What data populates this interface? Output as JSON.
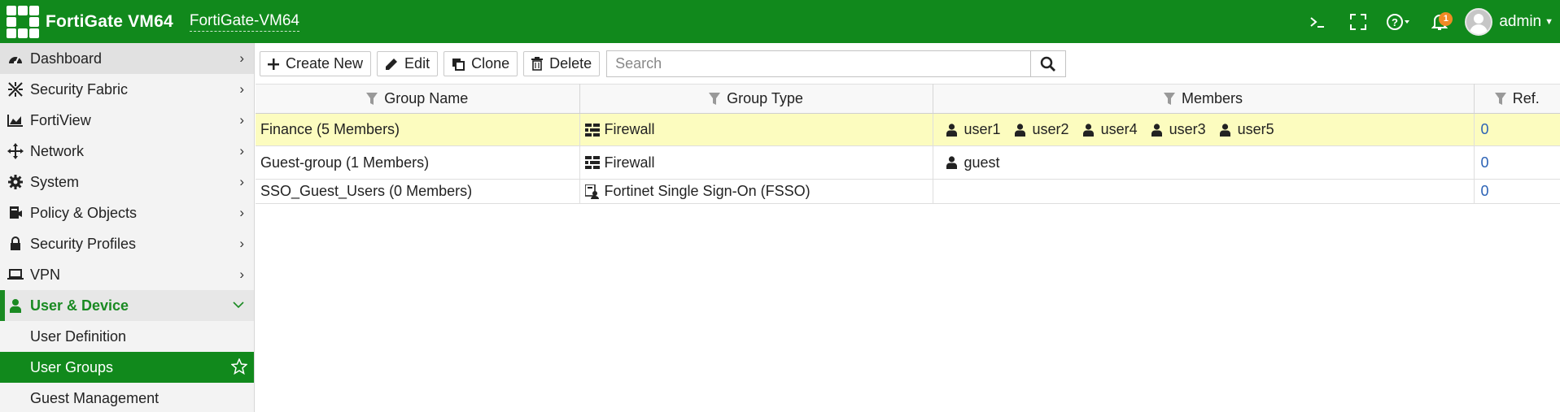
{
  "header": {
    "product": "FortiGate VM64",
    "hostname": "FortiGate-VM64",
    "notification_count": "1",
    "user": "admin"
  },
  "sidebar": {
    "items": [
      {
        "label": "Dashboard",
        "icon": "dashboard-icon"
      },
      {
        "label": "Security Fabric",
        "icon": "security-fabric-icon"
      },
      {
        "label": "FortiView",
        "icon": "fortiview-chart-icon"
      },
      {
        "label": "Network",
        "icon": "network-arrows-icon"
      },
      {
        "label": "System",
        "icon": "gear-icon"
      },
      {
        "label": "Policy & Objects",
        "icon": "policy-objects-icon"
      },
      {
        "label": "Security Profiles",
        "icon": "lock-icon"
      },
      {
        "label": "VPN",
        "icon": "laptop-icon"
      },
      {
        "label": "User & Device",
        "icon": "user-icon"
      }
    ],
    "subitems": [
      {
        "label": "User Definition"
      },
      {
        "label": "User Groups"
      },
      {
        "label": "Guest Management"
      }
    ]
  },
  "toolbar": {
    "create_label": "Create New",
    "edit_label": "Edit",
    "clone_label": "Clone",
    "delete_label": "Delete",
    "search_placeholder": "Search"
  },
  "table": {
    "columns": [
      "Group Name",
      "Group Type",
      "Members",
      "Ref."
    ],
    "rows": [
      {
        "name": "Finance (5 Members)",
        "type": "Firewall",
        "members": [
          "user1",
          "user2",
          "user4",
          "user3",
          "user5"
        ],
        "ref": "0"
      },
      {
        "name": "Guest-group (1 Members)",
        "type": "Firewall",
        "members": [
          "guest"
        ],
        "ref": "0"
      },
      {
        "name": "SSO_Guest_Users (0 Members)",
        "type": "Fortinet Single Sign-On (FSSO)",
        "members": [],
        "ref": "0"
      }
    ]
  },
  "colors": {
    "brand_green": "#11891c",
    "selected_row": "#fcfcbf",
    "notification_badge": "#f08a24",
    "link_blue": "#2b62b5"
  }
}
